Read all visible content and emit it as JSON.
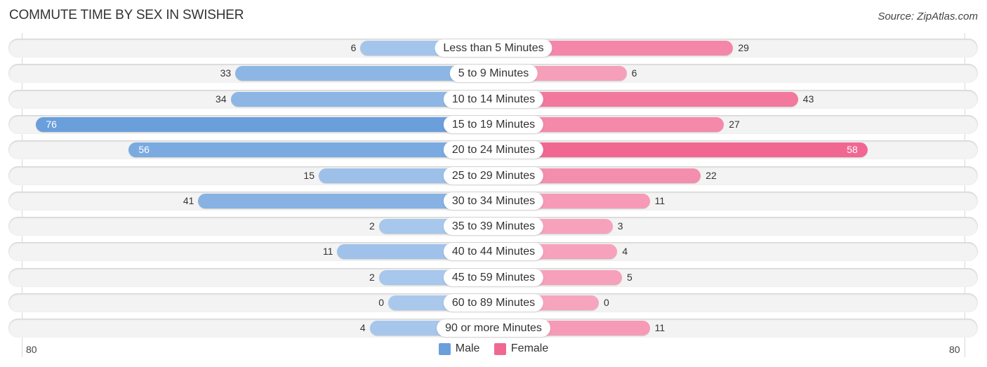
{
  "title": "COMMUTE TIME BY SEX IN SWISHER",
  "source": "Source: ZipAtlas.com",
  "colors": {
    "male": "#6a9fdc",
    "male_light": "#a9c8ec",
    "female": "#f06892",
    "female_light": "#f7a5bf"
  },
  "chart_data": {
    "type": "bar",
    "orientation": "horizontal-diverging",
    "title": "COMMUTE TIME BY SEX IN SWISHER",
    "categories": [
      "Less than 5 Minutes",
      "5 to 9 Minutes",
      "10 to 14 Minutes",
      "15 to 19 Minutes",
      "20 to 24 Minutes",
      "25 to 29 Minutes",
      "30 to 34 Minutes",
      "35 to 39 Minutes",
      "40 to 44 Minutes",
      "45 to 59 Minutes",
      "60 to 89 Minutes",
      "90 or more Minutes"
    ],
    "series": [
      {
        "name": "Male",
        "values": [
          6,
          33,
          34,
          76,
          56,
          15,
          41,
          2,
          11,
          2,
          0,
          4
        ]
      },
      {
        "name": "Female",
        "values": [
          29,
          6,
          43,
          27,
          58,
          22,
          11,
          3,
          4,
          5,
          0,
          11
        ]
      }
    ],
    "axis_min_label": "80",
    "axis_max_label": "80",
    "xlim": [
      -80,
      80
    ],
    "legend": [
      "Male",
      "Female"
    ],
    "legend_position": "bottom-center"
  }
}
